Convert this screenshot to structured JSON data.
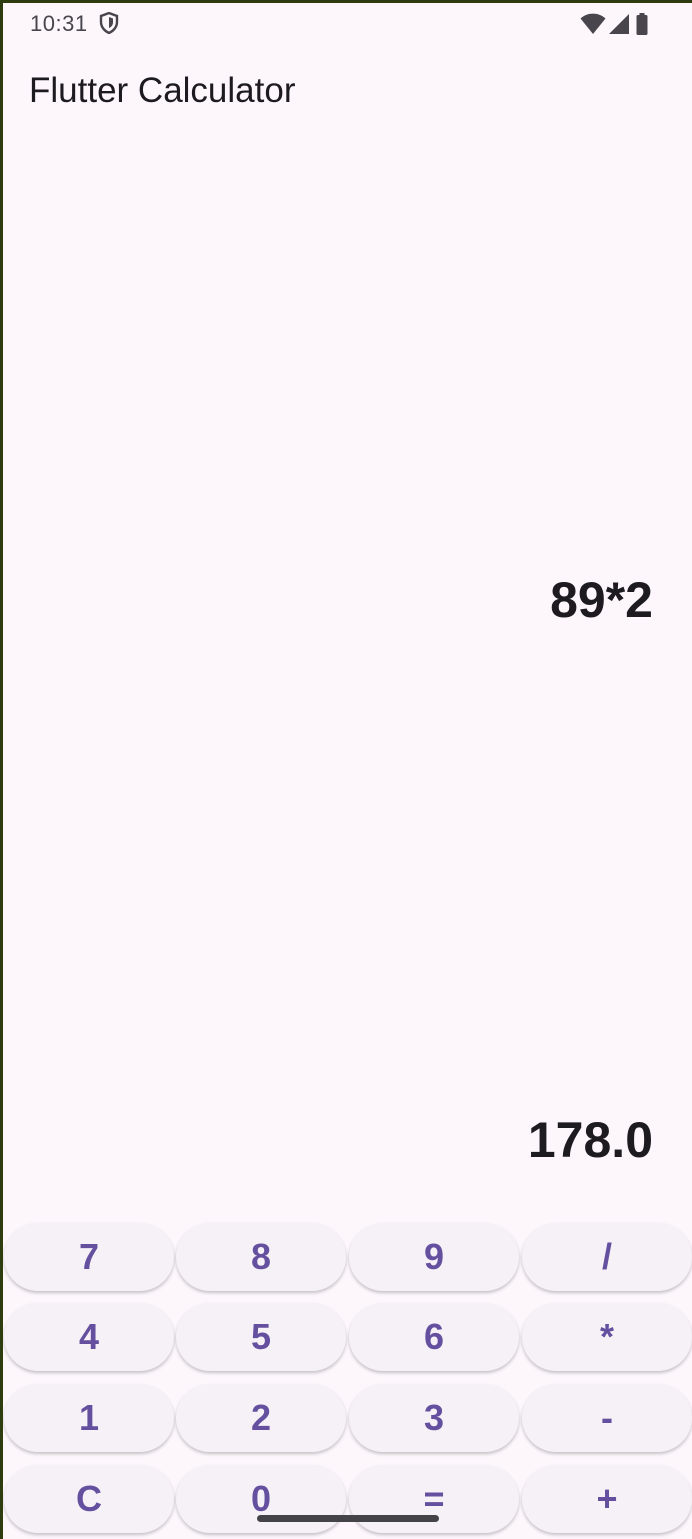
{
  "status_bar": {
    "time": "10:31",
    "icons": [
      "shield-icon",
      "wifi-icon",
      "signal-icon",
      "battery-icon"
    ]
  },
  "app_bar": {
    "title": "Flutter Calculator"
  },
  "display": {
    "expression": "89*2",
    "result": "178.0"
  },
  "keypad": {
    "rows": [
      [
        "7",
        "8",
        "9",
        "/"
      ],
      [
        "4",
        "5",
        "6",
        "*"
      ],
      [
        "1",
        "2",
        "3",
        "-"
      ],
      [
        "C",
        "0",
        "=",
        "+"
      ]
    ]
  },
  "colors": {
    "background": "#fdf7fc",
    "button_bg": "#f5f1f7",
    "button_text": "#65509f",
    "text_primary": "#1d1b20"
  }
}
